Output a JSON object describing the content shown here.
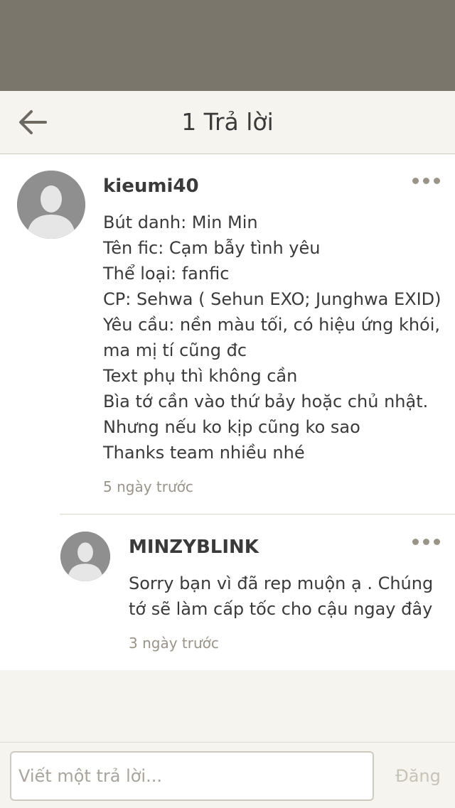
{
  "header": {
    "title": "1 Trả lời",
    "back_icon": "arrow-left-icon"
  },
  "comment": {
    "username": "kieumi40",
    "lines": [
      "Bút danh: Min Min",
      "Tên fic: Cạm bẫy tình yêu",
      "Thể loại: fanfic",
      "CP: Sehwa ( Sehun EXO; Junghwa EXID)",
      "Yêu cầu: nền màu tối, có hiệu ứng khói,",
      "ma mị tí cũng đc",
      "Text phụ thì không cần",
      "Bìa tớ cần vào thứ bảy hoặc chủ nhật.",
      "Nhưng nếu ko kịp cũng ko sao",
      "Thanks team nhiều nhé"
    ],
    "time": "5 ngày trước"
  },
  "reply": {
    "username": "MINZYBLINK",
    "lines": [
      "Sorry bạn vì đã rep muộn ạ . Chúng",
      "tớ sẽ làm cấp tốc cho cậu ngay đây"
    ],
    "time": "3 ngày trước"
  },
  "composer": {
    "placeholder": "Viết một trả lời...",
    "post_label": "Đăng"
  },
  "colors": {
    "topbar": "#7b766c",
    "background": "#f6f4ee",
    "text": "#3a3a3a",
    "muted": "#9a9488",
    "avatar": "#8f8f8f"
  }
}
